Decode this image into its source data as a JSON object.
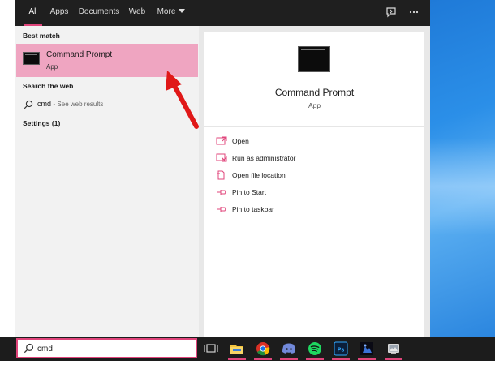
{
  "tabs": [
    {
      "label": "All"
    },
    {
      "label": "Apps"
    },
    {
      "label": "Documents"
    },
    {
      "label": "Web"
    },
    {
      "label": "More"
    }
  ],
  "left_panel": {
    "best_match_heading": "Best match",
    "best_match": {
      "title": "Command Prompt",
      "subtitle": "App",
      "icon": "command-prompt-icon"
    },
    "search_web_heading": "Search the web",
    "web_result": {
      "query": "cmd",
      "suffix": "- See web results",
      "icon": "search-icon"
    },
    "settings_label": "Settings (1)"
  },
  "detail_panel": {
    "title": "Command Prompt",
    "subtitle": "App",
    "actions": [
      {
        "label": "Open",
        "icon": "open-icon"
      },
      {
        "label": "Run as administrator",
        "icon": "run-as-admin-icon"
      },
      {
        "label": "Open file location",
        "icon": "file-location-icon"
      },
      {
        "label": "Pin to Start",
        "icon": "pin-icon"
      },
      {
        "label": "Pin to taskbar",
        "icon": "pin-icon"
      }
    ]
  },
  "search_box": {
    "value": "cmd",
    "icon": "search-icon"
  },
  "taskbar_apps": [
    "task-view",
    "file-explorer",
    "chrome",
    "discord",
    "spotify",
    "photoshop",
    "app-dark-blue",
    "app-gray"
  ],
  "colors": {
    "accent": "#e0457b",
    "selected_bg": "#efa5c1",
    "topbar": "#1f1f1f",
    "taskbar": "#1c1c1c",
    "annotation_arrow": "#e01818"
  }
}
